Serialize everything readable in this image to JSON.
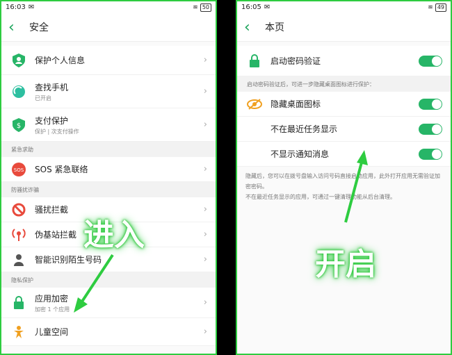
{
  "left": {
    "status": {
      "time": "16:03",
      "battery": "50"
    },
    "title": "安全",
    "items": [
      {
        "label": "保护个人信息",
        "sub": ""
      },
      {
        "label": "查找手机",
        "sub": "已开启"
      },
      {
        "label": "支付保护",
        "sub": "保护 | 次支付操作"
      }
    ],
    "section1": "紧急求助",
    "sos": {
      "label": "SOS 紧急联络"
    },
    "section2": "防骚扰诈骗",
    "items2": [
      {
        "label": "骚扰拦截"
      },
      {
        "label": "伪基站拦截"
      },
      {
        "label": "智能识别陌生号码"
      }
    ],
    "section3": "隐私保护",
    "items3": [
      {
        "label": "应用加密",
        "sub": "加密 1 个应用"
      },
      {
        "label": "儿童空间",
        "sub": ""
      }
    ],
    "overlay": "进入"
  },
  "right": {
    "status": {
      "time": "16:05",
      "battery": "49"
    },
    "title": "本页",
    "item_password": "启动密码验证",
    "section": "启动密码验证后，可进一步隐藏桌面图标进行保护：",
    "hide_icon": "隐藏桌面图标",
    "no_recent": "不在最近任务显示",
    "no_notify": "不显示通知消息",
    "note1": "隐藏后，您可以在拨号盘输入访问号码直接启动应用，此外打开应用无需验证加密密码。",
    "note2": "不在最近任务显示的应用，可通过一键清理功能从后台清理。",
    "overlay": "开启"
  },
  "colors": {
    "accent": "#27b567",
    "glow": "#2ecc40"
  }
}
